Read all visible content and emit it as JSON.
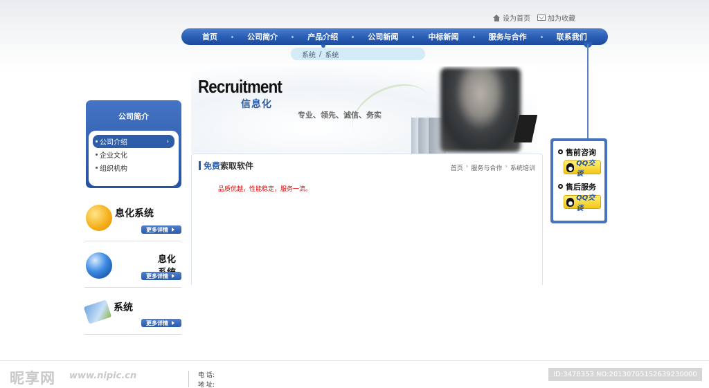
{
  "top_links": {
    "home": "设为首页",
    "favorite": "加为收藏"
  },
  "nav": {
    "items": [
      "首页",
      "公司简介",
      "产品介绍",
      "公司新闻",
      "中标新闻",
      "服务与合作",
      "联系我们"
    ]
  },
  "breadcrumb_bar": {
    "part1": "系统",
    "sep": "/",
    "part2": "系统"
  },
  "banner": {
    "title": "Recruitment",
    "subtitle": "信息化",
    "slogan": "专业、领先、诚信、务实"
  },
  "sidebar": {
    "title": "公司简介",
    "items": [
      "公司介绍",
      "企业文化",
      "组织机构"
    ],
    "active_chevron": "›"
  },
  "promo_cards": [
    {
      "title": "息化系统",
      "more": "更多详情"
    },
    {
      "title": "息化系统",
      "more": "更多详情"
    },
    {
      "title": "系统",
      "more": "更多详情"
    }
  ],
  "main": {
    "title_highlight": "免费",
    "title_rest": "索取软件",
    "crumb": [
      "首页",
      "服务与合作",
      "系统培训"
    ],
    "crumb_sep": "›",
    "text": "品质优越，性能稳定，服务一流。"
  },
  "service": {
    "presale": "售前咨询",
    "aftersale": "售后服务",
    "qq_label": "QQ交谈"
  },
  "footer": {
    "logo": "昵享网",
    "url": "www.nipic.cn",
    "phone_label": "电  话:",
    "address_label": "地  址:",
    "id_text": "ID:3478353 NO:20130705152639230000"
  },
  "colors": {
    "brand_blue": "#2d5da8",
    "highlight_red": "#e00000",
    "qq_yellow": "#f2c717"
  }
}
